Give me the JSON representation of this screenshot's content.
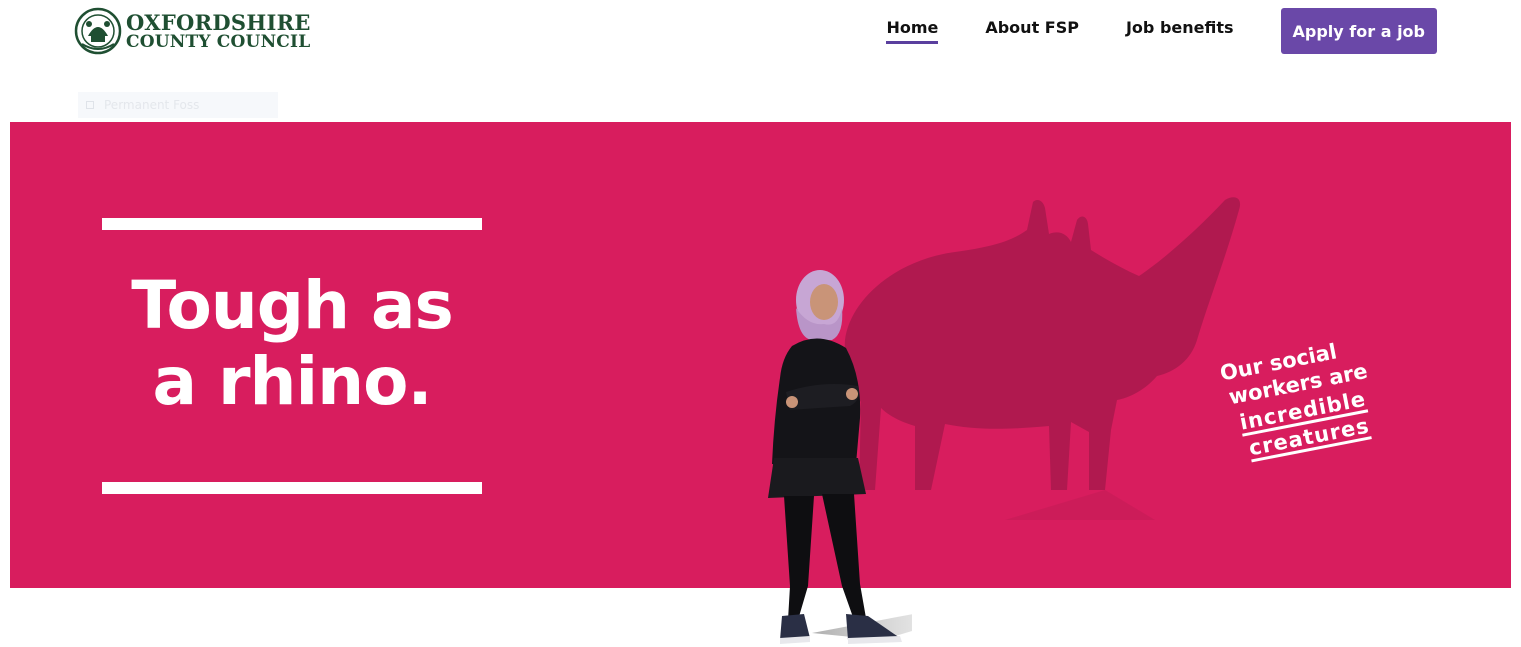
{
  "header": {
    "logo": {
      "line1": "OXFORDSHIRE",
      "line2": "COUNTY COUNCIL"
    },
    "nav": {
      "items": [
        {
          "label": "Home",
          "active": true
        },
        {
          "label": "About FSP",
          "active": false
        },
        {
          "label": "Job benefits",
          "active": false
        }
      ],
      "cta_label": "Apply for a job"
    }
  },
  "breadcrumb": {
    "label": "Permanent Foss"
  },
  "hero": {
    "headline": [
      "Tough as",
      "a rhino."
    ],
    "tagline": [
      "Our social",
      "workers are",
      "incredible",
      "creatures"
    ]
  },
  "colors": {
    "hero_bg": "#d81d5e",
    "rhino_shadow": "#b0194f",
    "nav_accent": "#5a3f9e",
    "button_bg": "#6a48a8",
    "logo_green": "#1f4f32"
  }
}
